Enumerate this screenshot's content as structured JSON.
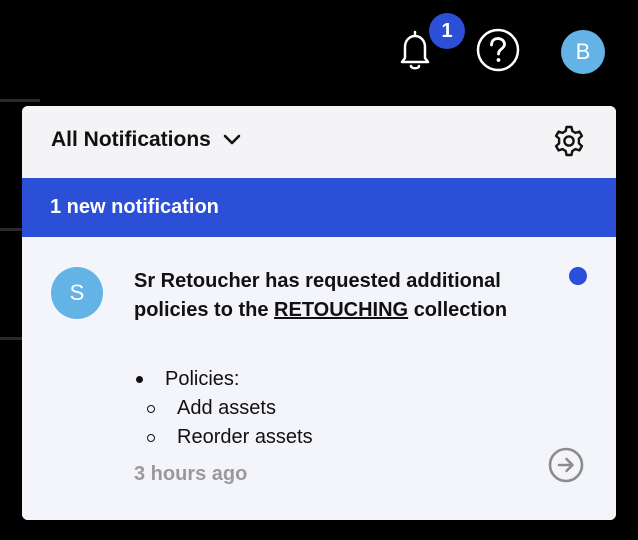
{
  "topbar": {
    "notification_count": "1",
    "user_initial": "B",
    "icons": [
      "bell-icon",
      "help-icon"
    ]
  },
  "panel": {
    "filter_label": "All Notifications",
    "new_banner": "1 new notification",
    "notification": {
      "sender_initial": "S",
      "message_prefix": "Sr Retoucher has requested additional policies to the",
      "collection_name": "RETOUCHING",
      "message_suffix": "collection",
      "details_label": "Policies:",
      "policies": [
        "Add assets",
        "Reorder assets"
      ],
      "timestamp": "3 hours ago",
      "unread": true
    }
  },
  "colors": {
    "accent": "#2b4fd6",
    "avatar": "#63b3e6",
    "timestamp": "#9a9a9a"
  }
}
